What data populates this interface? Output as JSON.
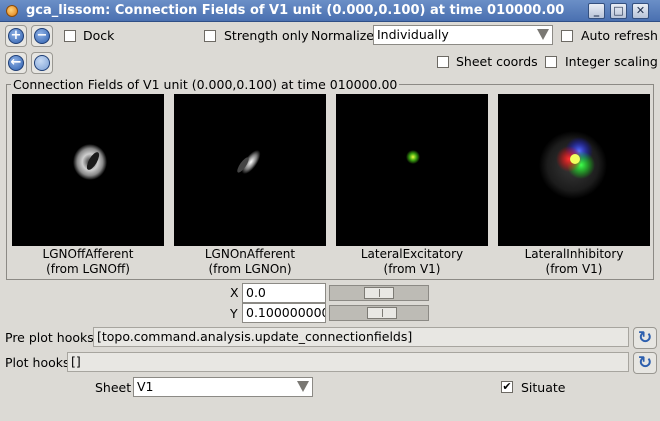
{
  "window": {
    "title": "gca_lissom: Connection Fields of V1 unit (0.000,0.100) at time 010000.00",
    "controls": {
      "minimize": "_",
      "maximize": "□",
      "close": "✕"
    }
  },
  "toolbar": {
    "zoom_in_glyph": "+",
    "zoom_out_glyph": "−",
    "back_glyph": "←",
    "dock": {
      "label": "Dock",
      "checked": ""
    },
    "strength_only": {
      "label": "Strength only",
      "checked": ""
    },
    "normalize": {
      "label": "Normalize",
      "value": "Individually"
    },
    "auto_refresh": {
      "label": "Auto refresh",
      "checked": ""
    },
    "sheet_coords": {
      "label": "Sheet coords",
      "checked": ""
    },
    "integer_scaling": {
      "label": "Integer scaling",
      "checked": ""
    }
  },
  "plot_group": {
    "title": "Connection Fields of V1 unit (0.000,0.100) at time 010000.00",
    "plots": [
      {
        "name": "LGNOffAfferent",
        "source": "(from LGNOff)"
      },
      {
        "name": "LGNOnAfferent",
        "source": "(from LGNOn)"
      },
      {
        "name": "LateralExcitatory",
        "source": "(from V1)"
      },
      {
        "name": "LateralInhibitory",
        "source": "(from V1)"
      }
    ]
  },
  "coords": {
    "x": {
      "label": "X",
      "value": "0.0",
      "fraction": 0.5
    },
    "y": {
      "label": "Y",
      "value": "0.100000000",
      "fraction": 0.55
    }
  },
  "hooks": {
    "pre_plot": {
      "label": "Pre plot hooks",
      "value": "[topo.command.analysis.update_connectionfields]"
    },
    "plot": {
      "label": "Plot hooks",
      "value": "[]"
    },
    "refresh_glyph": "↻"
  },
  "sheet": {
    "label": "Sheet",
    "value": "V1"
  },
  "situate": {
    "label": "Situate",
    "checked": "✔"
  }
}
